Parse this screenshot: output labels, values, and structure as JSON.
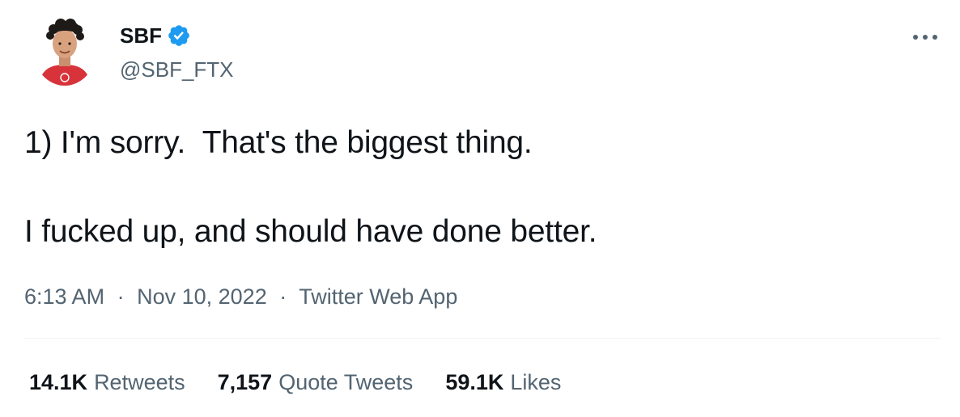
{
  "author": {
    "display_name": "SBF",
    "handle": "@SBF_FTX",
    "verified": true,
    "avatar_icon": "user-avatar-illustration"
  },
  "tweet": {
    "paragraphs": [
      "1) I'm sorry.  That's the biggest thing.",
      "I fucked up, and should have done better."
    ]
  },
  "meta": {
    "time": "6:13 AM",
    "date": "Nov 10, 2022",
    "source": "Twitter Web App",
    "separator": "·"
  },
  "stats": {
    "retweets": {
      "count": "14.1K",
      "label": "Retweets"
    },
    "quote_tweets": {
      "count": "7,157",
      "label": "Quote Tweets"
    },
    "likes": {
      "count": "59.1K",
      "label": "Likes"
    }
  },
  "colors": {
    "text_primary": "#0f1419",
    "text_secondary": "#536471",
    "verified_blue": "#1d9bf0",
    "divider": "#eff3f4"
  },
  "icons": {
    "verified": "verified-badge-icon",
    "more": "more-options-icon"
  }
}
